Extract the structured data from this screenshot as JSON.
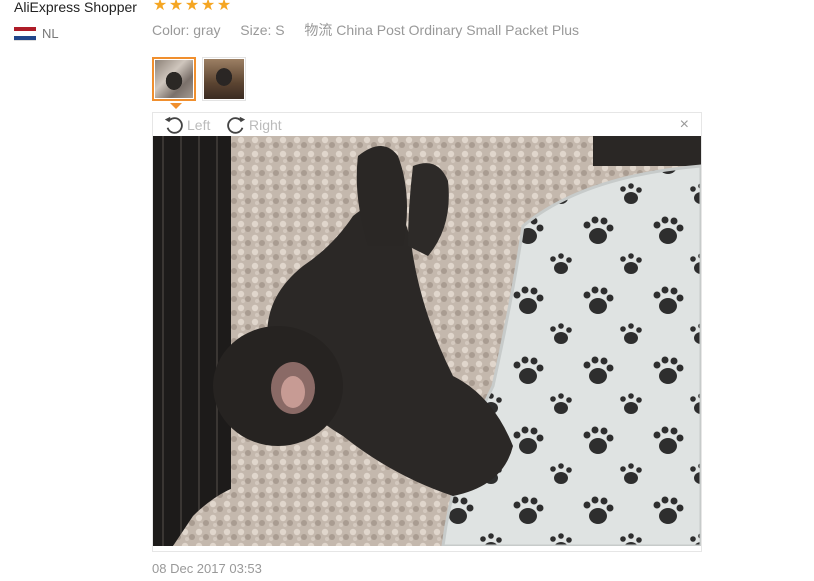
{
  "review": {
    "shopper_name": "AliExpress Shopper",
    "rating": 5,
    "stars": [
      "★",
      "★",
      "★",
      "★",
      "★"
    ],
    "country_code": "NL",
    "flag_colors": [
      "#ae1c28",
      "#ffffff",
      "#21468b"
    ],
    "color_label": "Color:",
    "color_value": "gray",
    "size_label": "Size:",
    "size_value": "S",
    "shipping_label": "物流",
    "shipping_value": "China Post Ordinary Small Packet Plus",
    "timestamp": "08 Dec 2017 03:53"
  },
  "thumbnails": [
    {
      "name": "photo-1",
      "active": true
    },
    {
      "name": "photo-2",
      "active": false
    }
  ],
  "viewer": {
    "rotate_left_label": "Left",
    "rotate_right_label": "Right",
    "close_glyph": "×",
    "rotate_left_icon": "rotate-left-icon",
    "rotate_right_icon": "rotate-right-icon",
    "close_icon": "close-icon"
  },
  "colors": {
    "star": "#f5a623",
    "accent_border": "#f08f2e",
    "muted_text": "#999999"
  }
}
